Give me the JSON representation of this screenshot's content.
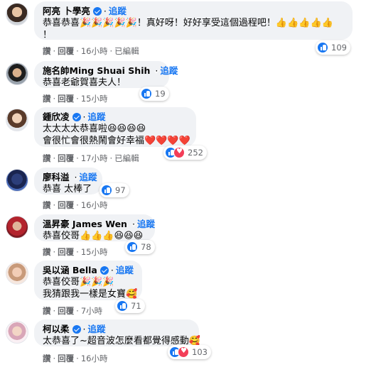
{
  "comments": [
    {
      "name": "阿亮 卜學亮",
      "dot": "·",
      "follow": "追蹤",
      "lines": [
        "恭喜恭喜🎉🎉🎉🎉🎉！真好呀！好好享受這個過程吧！👍👍👍👍👍",
        "！"
      ],
      "reactions": [
        "like"
      ],
      "count": "109",
      "actions": [
        "讚",
        "回覆",
        "16小時",
        "已編輯"
      ]
    },
    {
      "name": "施名帥Ming Shuai Shih",
      "dot": "·",
      "follow": "追蹤",
      "lines": [
        "恭喜老爺賀喜夫人！"
      ],
      "reactions": [
        "like"
      ],
      "count": "19",
      "actions": [
        "讚",
        "回覆",
        "15小時"
      ]
    },
    {
      "name": "鍾欣凌",
      "dot": "·",
      "follow": "追蹤",
      "lines": [
        "太太太太恭喜啦😆😆😆😆",
        "會很忙會很熱鬧會好幸福❤️❤️❤️❤️"
      ],
      "reactions": [
        "like",
        "love"
      ],
      "count": "252",
      "actions": [
        "讚",
        "回覆",
        "17小時",
        "已編輯"
      ]
    },
    {
      "name": "廖科溢",
      "dot": "·",
      "follow": "追蹤",
      "lines": [
        "恭喜 太棒了"
      ],
      "reactions": [
        "like"
      ],
      "count": "97",
      "actions": [
        "讚",
        "回覆",
        "16小時"
      ]
    },
    {
      "name": "溫昇豪 James Wen",
      "dot": "·",
      "follow": "追蹤",
      "lines": [
        "恭喜佼哥👍👍👍😆😆😆"
      ],
      "reactions": [
        "like"
      ],
      "count": "78",
      "actions": [
        "讚",
        "回覆",
        "15小時"
      ]
    },
    {
      "name": "吳以涵 Bella",
      "dot": "·",
      "follow": "追蹤",
      "lines": [
        "恭喜佼哥🎉🎉🎉",
        "我猜跟我一樣是女寶🥰"
      ],
      "reactions": [
        "like"
      ],
      "count": "71",
      "actions": [
        "讚",
        "回覆",
        "7小時"
      ]
    },
    {
      "name": "柯以柔",
      "dot": "·",
      "follow": "追蹤",
      "lines": [
        "太恭喜了~超音波怎麼看都覺得感動🥰"
      ],
      "reactions": [
        "like",
        "love"
      ],
      "count": "103",
      "actions": [
        "讚",
        "回覆",
        "16小時"
      ]
    }
  ],
  "colors": {
    "bubble": "#f0f2f5",
    "link": "#1877f2",
    "meta": "#65676b",
    "like": "#1877f2",
    "love": "#f33e58"
  }
}
